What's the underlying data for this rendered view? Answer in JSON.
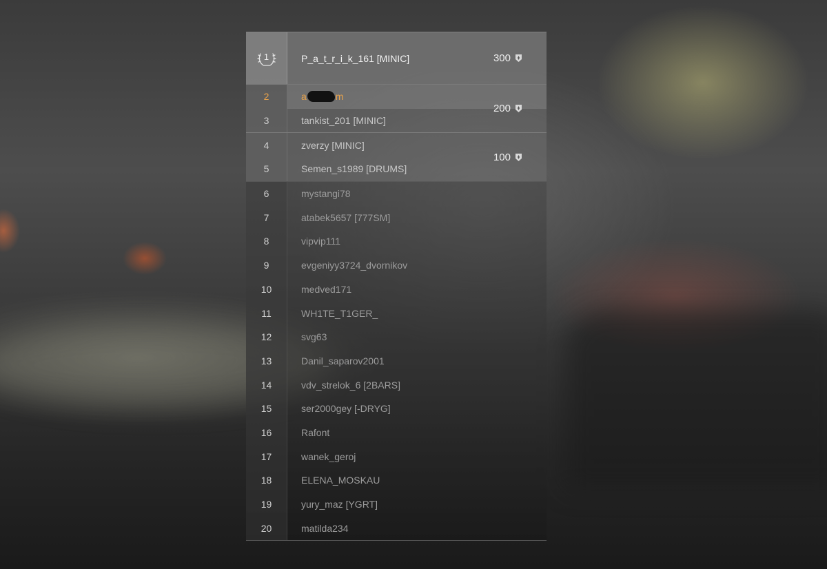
{
  "first": {
    "rank": "1",
    "name": "P_a_t_r_i_k_161 [MINIC]",
    "reward": "300"
  },
  "group2": {
    "reward": "200",
    "rows": [
      {
        "rank": "2",
        "name_start": "a",
        "name_end": "m"
      },
      {
        "rank": "3",
        "name": "tankist_201 [MINIC]"
      }
    ]
  },
  "group3": {
    "reward": "100",
    "rows": [
      {
        "rank": "4",
        "name": "zverzy [MINIC]"
      },
      {
        "rank": "5",
        "name": "Semen_s1989 [DRUMS]"
      }
    ]
  },
  "rest": [
    {
      "rank": "6",
      "name": "mystangi78"
    },
    {
      "rank": "7",
      "name": "atabek5657 [777SM]"
    },
    {
      "rank": "8",
      "name": "vipvip111"
    },
    {
      "rank": "9",
      "name": "evgeniyy3724_dvornikov"
    },
    {
      "rank": "10",
      "name": "medved171"
    },
    {
      "rank": "11",
      "name": "WH1TE_T1GER_"
    },
    {
      "rank": "12",
      "name": "svg63"
    },
    {
      "rank": "13",
      "name": "Danil_saparov2001"
    },
    {
      "rank": "14",
      "name": "vdv_strelok_6 [2BARS]"
    },
    {
      "rank": "15",
      "name": "ser2000gey [-DRYG]"
    },
    {
      "rank": "16",
      "name": "Rafont"
    },
    {
      "rank": "17",
      "name": "wanek_geroj"
    },
    {
      "rank": "18",
      "name": "ELENA_MOSKAU"
    },
    {
      "rank": "19",
      "name": "yury_maz [YGRT]"
    },
    {
      "rank": "20",
      "name": "matilda234"
    }
  ],
  "icons": {
    "laurel": "laurel-wreath-icon",
    "reward": "bond-medal-icon"
  },
  "colors": {
    "highlight": "#e9a24a",
    "text_primary": "#f2f2f2",
    "text_dim": "#9c9c9c"
  }
}
